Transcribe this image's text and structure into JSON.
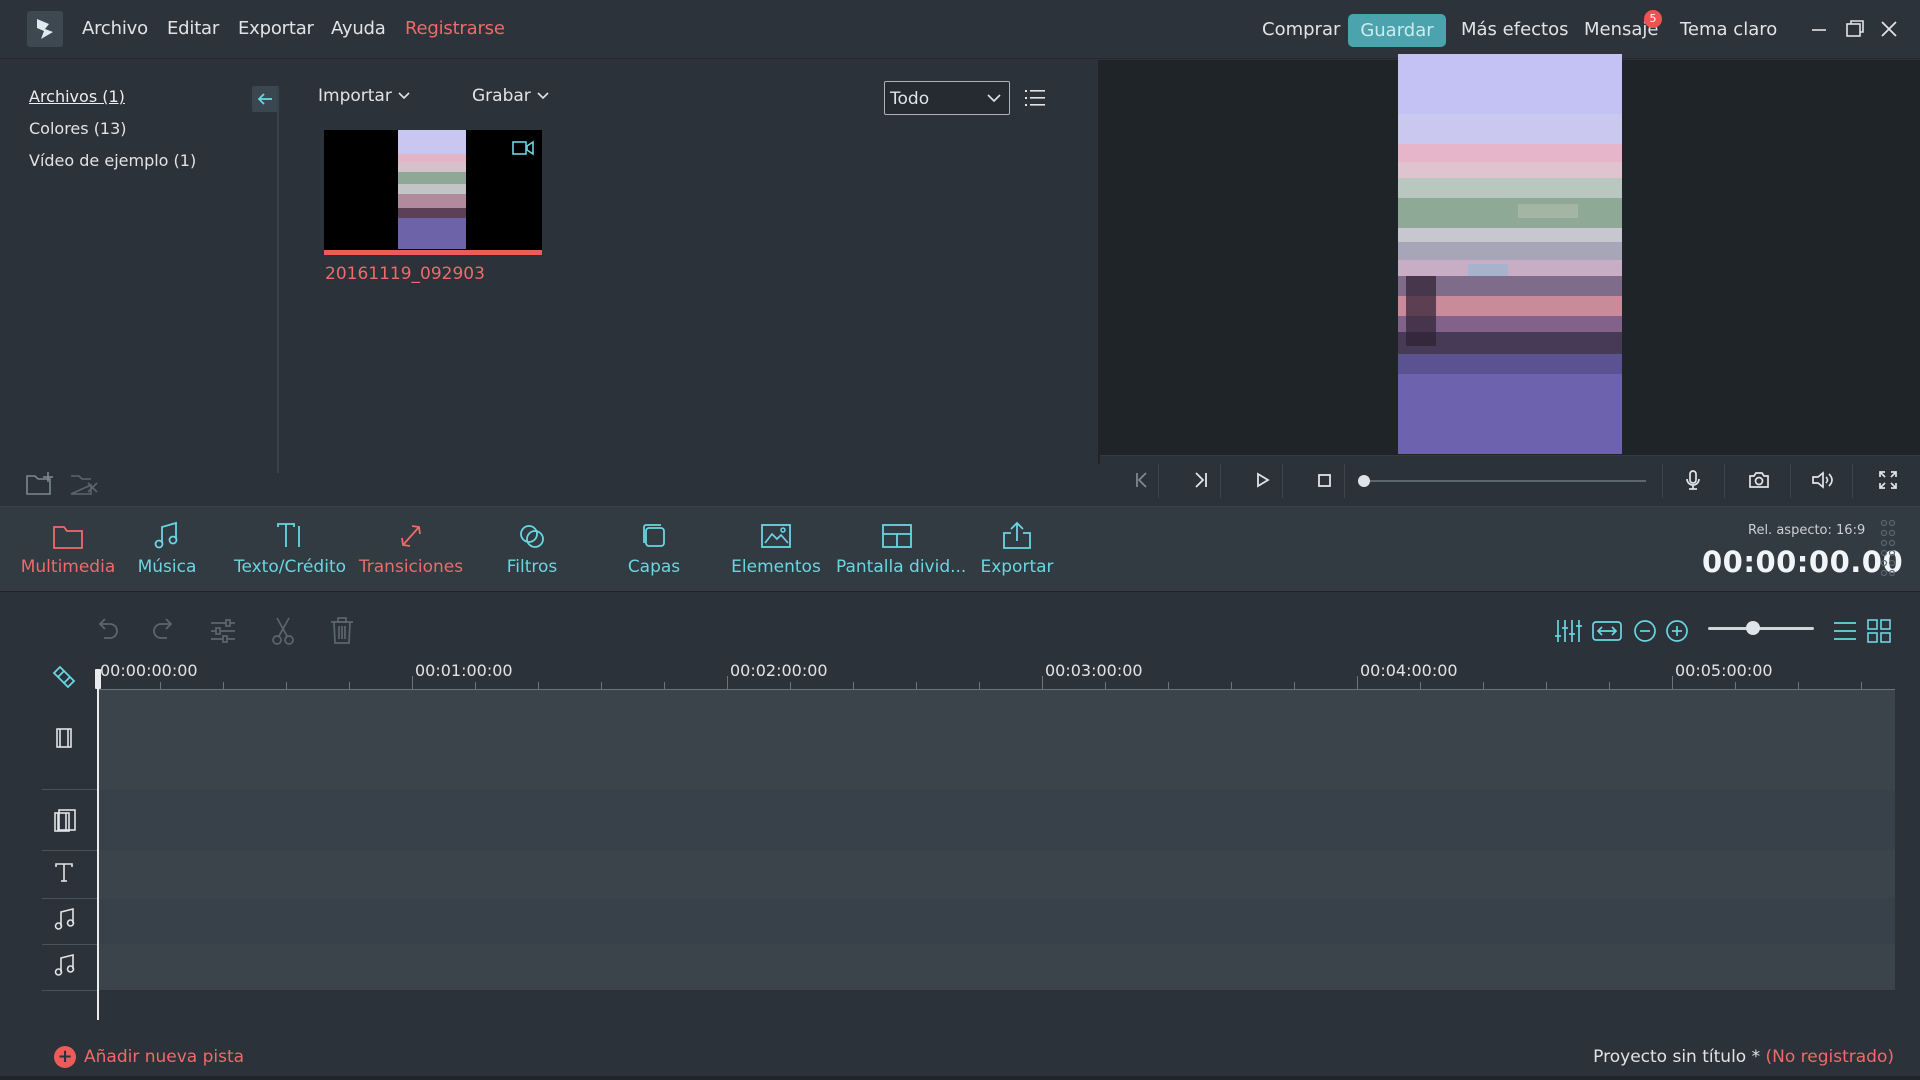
{
  "menu": {
    "archivo": "Archivo",
    "editar": "Editar",
    "exportar": "Exportar",
    "ayuda": "Ayuda",
    "registrarse": "Registrarse"
  },
  "header": {
    "comprar": "Comprar",
    "guardar": "Guardar",
    "mas_efectos": "Más efectos",
    "mensaje": "Mensaje",
    "mensaje_count": "5",
    "tema": "Tema claro"
  },
  "library": {
    "items": [
      {
        "label": "Archivos (1)"
      },
      {
        "label": "Colores (13)"
      },
      {
        "label": "Vídeo de ejemplo (1)"
      }
    ]
  },
  "media": {
    "importar": "Importar",
    "grabar": "Grabar",
    "filter_value": "Todo",
    "clip_name": "20161119_092903"
  },
  "toolbar": {
    "items": [
      {
        "label": "Multimedia"
      },
      {
        "label": "Música"
      },
      {
        "label": "Texto/Crédito"
      },
      {
        "label": "Transiciones"
      },
      {
        "label": "Filtros"
      },
      {
        "label": "Capas"
      },
      {
        "label": "Elementos"
      },
      {
        "label": "Pantalla divid..."
      },
      {
        "label": "Exportar"
      }
    ],
    "aspect": "Rel. aspecto: 16:9",
    "timecode": "00:00:00.00"
  },
  "timeline": {
    "ruler": [
      "00:00:00:00",
      "00:01:00:00",
      "00:02:00:00",
      "00:03:00:00",
      "00:04:00:00",
      "00:05:00:00"
    ],
    "zoom_level": 0.42
  },
  "status": {
    "add_track": "Añadir nueva pista",
    "project": "Proyecto sin título *",
    "unregistered": "(No registrado)"
  },
  "colors": {
    "accent": "#4aa3ad",
    "cyan_label": "#6ad6e2",
    "red": "#ef6a6a",
    "bg": "#2b3239"
  },
  "icons": [
    "app-logo-icon",
    "minimize-icon",
    "maximize-icon",
    "close-icon",
    "back-arrow-icon",
    "add-folder-icon",
    "delete-folder-icon",
    "list-view-icon",
    "video-camera-icon",
    "skip-back-icon",
    "step-forward-icon",
    "play-icon",
    "stop-icon",
    "microphone-icon",
    "snapshot-icon",
    "volume-icon",
    "fullscreen-icon",
    "folder-icon",
    "music-note-icon",
    "text-icon",
    "transition-icon",
    "filter-icon",
    "overlay-icon",
    "image-icon",
    "split-screen-icon",
    "export-icon",
    "undo-icon",
    "redo-icon",
    "adjust-icon",
    "cut-icon",
    "trash-icon",
    "audio-mixer-icon",
    "fit-icon",
    "zoom-out-icon",
    "zoom-in-icon",
    "list-icon",
    "grid-icon",
    "snap-icon",
    "film-icon",
    "pip-icon",
    "text-track-icon",
    "music-track-icon"
  ]
}
